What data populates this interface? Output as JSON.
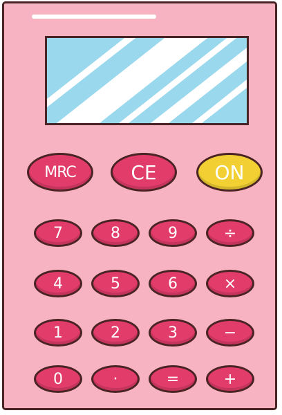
{
  "colors": {
    "body": "#f7b3c1",
    "outline": "#4a2424",
    "key": "#e13c6a",
    "on_key": "#f2d033",
    "screen": "#9ad8ee",
    "screen_shine": "#ffffff"
  },
  "function_keys": [
    {
      "name": "mrc-button",
      "label": "MRC"
    },
    {
      "name": "ce-button",
      "label": "CE"
    },
    {
      "name": "on-button",
      "label": "ON"
    }
  ],
  "keypad": [
    {
      "name": "key-7",
      "label": "7"
    },
    {
      "name": "key-8",
      "label": "8"
    },
    {
      "name": "key-9",
      "label": "9"
    },
    {
      "name": "divide-button",
      "label": "÷"
    },
    {
      "name": "key-4",
      "label": "4"
    },
    {
      "name": "key-5",
      "label": "5"
    },
    {
      "name": "key-6",
      "label": "6"
    },
    {
      "name": "multiply-button",
      "label": "×"
    },
    {
      "name": "key-1",
      "label": "1"
    },
    {
      "name": "key-2",
      "label": "2"
    },
    {
      "name": "key-3",
      "label": "3"
    },
    {
      "name": "minus-button",
      "label": "−"
    },
    {
      "name": "key-0",
      "label": "0"
    },
    {
      "name": "decimal-button",
      "label": "·"
    },
    {
      "name": "equals-button",
      "label": "="
    },
    {
      "name": "plus-button",
      "label": "+"
    }
  ]
}
